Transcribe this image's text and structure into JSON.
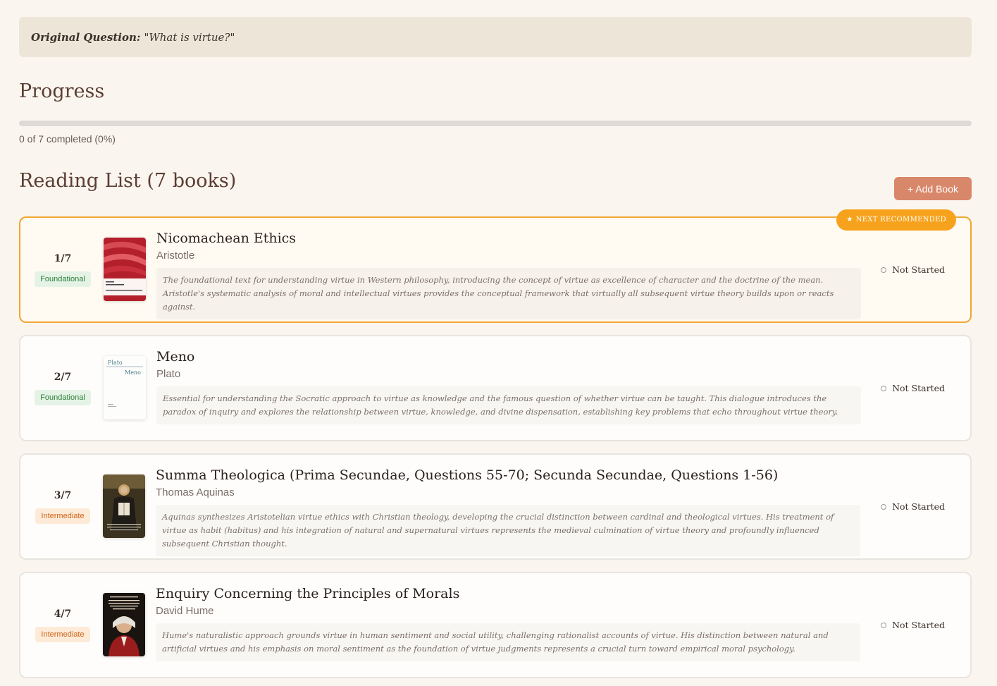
{
  "question": {
    "label": "Original Question:",
    "text": "\"What is virtue?\""
  },
  "progress": {
    "title": "Progress",
    "completed": 0,
    "total": 7,
    "fraction": 0.0,
    "text": "0 of 7 completed (0%)"
  },
  "reading_list": {
    "title": "Reading List (7 books)",
    "add_button_label": "+ Add Book",
    "recommended_badge": "NEXT RECOMMENDED",
    "books": [
      {
        "order": "1/7",
        "level": "Foundational",
        "title": "Nicomachean Ethics",
        "author": "Aristotle",
        "description": "The foundational text for understanding virtue in Western philosophy, introducing the concept of virtue as excellence of character and the doctrine of the mean. Aristotle's systematic analysis of moral and intellectual virtues provides the conceptual framework that virtually all subsequent virtue theory builds upon or reacts against.",
        "status": "Not Started"
      },
      {
        "order": "2/7",
        "level": "Foundational",
        "title": "Meno",
        "author": "Plato",
        "cover_author": "Plato",
        "cover_title": "Meno",
        "description": "Essential for understanding the Socratic approach to virtue as knowledge and the famous question of whether virtue can be taught. This dialogue introduces the paradox of inquiry and explores the relationship between virtue, knowledge, and divine dispensation, establishing key problems that echo throughout virtue theory.",
        "status": "Not Started"
      },
      {
        "order": "3/7",
        "level": "Intermediate",
        "title": "Summa Theologica (Prima Secundae, Questions 55-70; Secunda Secundae, Questions 1-56)",
        "author": "Thomas Aquinas",
        "description": "Aquinas synthesizes Aristotelian virtue ethics with Christian theology, developing the crucial distinction between cardinal and theological virtues. His treatment of virtue as habit (habitus) and his integration of natural and supernatural virtues represents the medieval culmination of virtue theory and profoundly influenced subsequent Christian thought.",
        "status": "Not Started"
      },
      {
        "order": "4/7",
        "level": "Intermediate",
        "title": "Enquiry Concerning the Principles of Morals",
        "author": "David Hume",
        "description": "Hume's naturalistic approach grounds virtue in human sentiment and social utility, challenging rationalist accounts of virtue. His distinction between natural and artificial virtues and his emphasis on moral sentiment as the foundation of virtue judgments represents a crucial turn toward empirical moral psychology.",
        "status": "Not Started"
      }
    ]
  },
  "colors": {
    "accent": "#d9876a",
    "highlight_border": "#f2a531",
    "badge": "#f7a21c"
  }
}
